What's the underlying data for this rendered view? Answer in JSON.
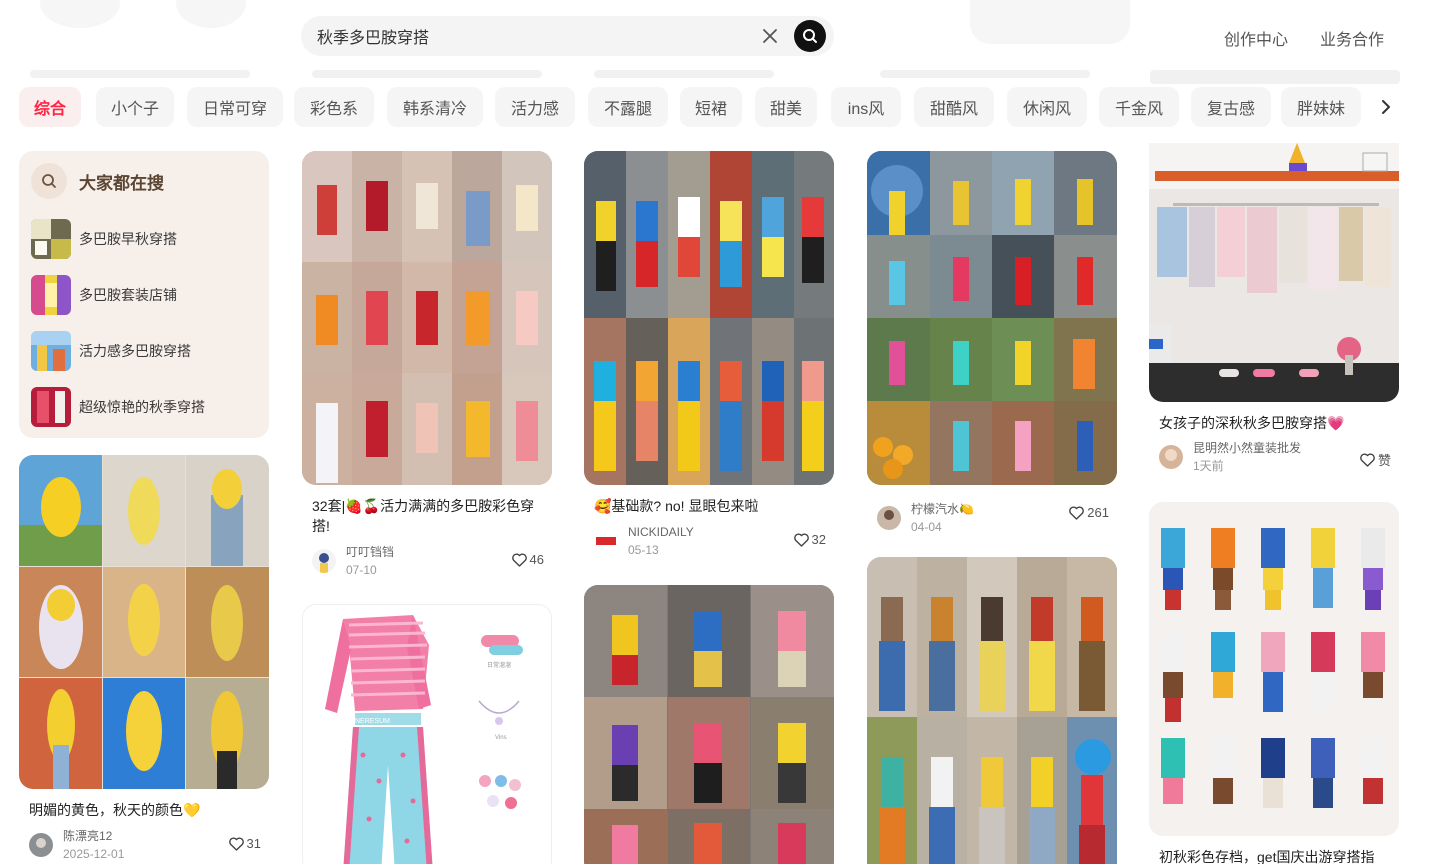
{
  "search": {
    "value": "秋季多巴胺穿搭"
  },
  "header": {
    "links": [
      "创作中心",
      "业务合作"
    ]
  },
  "tabs": [
    "综合",
    "小个子",
    "日常可穿",
    "彩色系",
    "韩系清冷",
    "活力感",
    "不露腿",
    "短裙",
    "甜美",
    "ins风",
    "甜酷风",
    "休闲风",
    "千金风",
    "复古感",
    "胖妹妹"
  ],
  "trending": {
    "title": "大家都在搜",
    "items": [
      "多巴胺早秋穿搭",
      "多巴胺套装店铺",
      "活力感多巴胺穿搭",
      "超级惊艳的秋季穿搭"
    ]
  },
  "notes": [
    {
      "title": "明媚的黄色，秋天的颜色💛",
      "author": "陈漂亮12",
      "date": "2025-12-01",
      "likes": "31"
    },
    {
      "title": "32套|🍓🍒活力满满的多巴胺彩色穿搭!",
      "author": "叮叮铛铛",
      "date": "07-10",
      "likes": "46"
    },
    {
      "title": "",
      "author": "",
      "date": "",
      "likes": ""
    },
    {
      "title": "🥰基础款? no! 显眼包来啦",
      "author": "NICKIDAILY",
      "date": "05-13",
      "likes": "32"
    },
    {
      "title": "",
      "author": "",
      "date": "",
      "likes": ""
    },
    {
      "title": "",
      "author": "柠檬汽水🍋",
      "date": "04-04",
      "likes": "261"
    },
    {
      "title": "",
      "author": "",
      "date": "",
      "likes": ""
    },
    {
      "title": "女孩子的深秋秋多巴胺穿搭💗",
      "author": "昆明然小然童装批发",
      "date": "1天前",
      "likes": "赞"
    },
    {
      "title": "初秋彩色存档，get国庆出游穿搭指",
      "author": "",
      "date": "",
      "likes": ""
    }
  ],
  "product_card": {
    "tags": [
      "NERESUM",
      "日常溜溜",
      "Vins"
    ]
  },
  "colors": {
    "accent": "#ff2442",
    "trend_bg": "#f7efe9",
    "tab_bg": "#f5f5f5"
  }
}
